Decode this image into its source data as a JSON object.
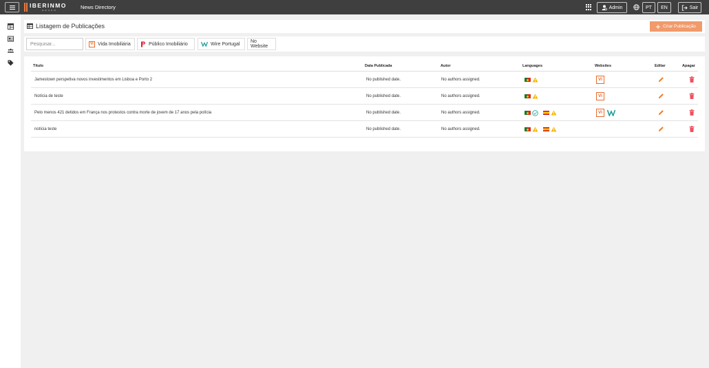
{
  "header": {
    "brand_name": "IBERINMO",
    "brand_sub": "GRUPO",
    "app_title": "News Directory",
    "admin_label": "Admin",
    "lang_pt": "PT",
    "lang_en": "EN",
    "logout_label": "Sair"
  },
  "sidebar": {
    "items": [
      {
        "icon": "dashboard-icon"
      },
      {
        "icon": "news-icon"
      },
      {
        "icon": "authors-icon"
      },
      {
        "icon": "tag-icon"
      }
    ]
  },
  "page": {
    "title": "Listagem de Publicações",
    "create_label": "Criar Publicação"
  },
  "filters": {
    "search_placeholder": "Pesquisar...",
    "websites": [
      "Vida Imobiliária",
      "Público Imobiliário",
      "Wire Portugal",
      "No Website"
    ]
  },
  "table": {
    "columns": [
      "Título",
      "Data Publicada",
      "Autor",
      "Languages",
      "Websites",
      "Editar",
      "Apagar"
    ],
    "rows": [
      {
        "title": "Jamestown perspetiva novos investimentos em Lisboa e Porto 2",
        "date": "No published date.",
        "author": "No authors assigned.",
        "languages": [
          "pt-flag",
          "warning-icon"
        ],
        "websites": [
          "vida-imobiliaria-logo"
        ]
      },
      {
        "title": "Notícia de teste",
        "date": "No published date.",
        "author": "No authors assigned.",
        "languages": [
          "pt-flag",
          "warning-icon"
        ],
        "websites": [
          "vida-imobiliaria-logo"
        ]
      },
      {
        "title": "Pelo menos 421 detidos em França nos protestos contra morte de jovem de 17 anos pela polícia",
        "date": "No published date.",
        "author": "No authors assigned.",
        "languages": [
          "pt-flag",
          "check-icon",
          "es-flag",
          "warning-icon"
        ],
        "websites": [
          "vida-imobiliaria-logo",
          "wire-portugal-logo"
        ]
      },
      {
        "title": "notícia teste",
        "date": "No published date.",
        "author": "No authors assigned.",
        "languages": [
          "pt-flag",
          "warning-icon",
          "es-flag",
          "warning-icon"
        ],
        "websites": []
      }
    ]
  },
  "colors": {
    "topbar": "#3f3f3f",
    "accent": "#f19a6b",
    "edit": "#f08030",
    "delete": "#f05060",
    "warning": "#f5b800",
    "check": "#2aa59a"
  }
}
